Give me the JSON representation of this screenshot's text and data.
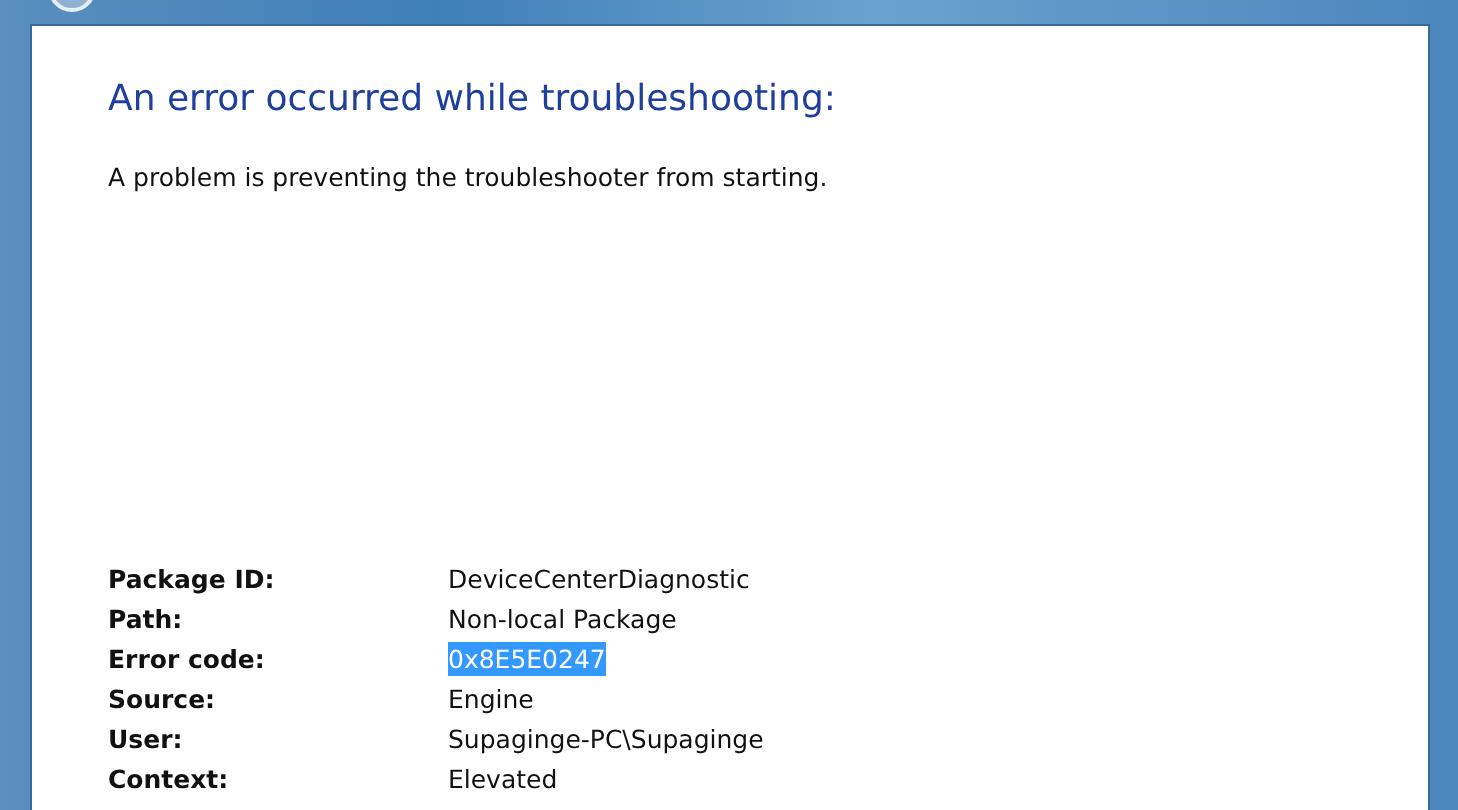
{
  "heading": "An error occurred while troubleshooting:",
  "message": "A problem is preventing the troubleshooter from starting.",
  "details": [
    {
      "label": "Package ID:",
      "value": "DeviceCenterDiagnostic",
      "selected": false
    },
    {
      "label": "Path:",
      "value": "Non-local Package",
      "selected": false
    },
    {
      "label": "Error code:",
      "value": "0x8E5E0247",
      "selected": true
    },
    {
      "label": "Source:",
      "value": "Engine",
      "selected": false
    },
    {
      "label": "User:",
      "value": "Supaginge-PC\\Supaginge",
      "selected": false
    },
    {
      "label": "Context:",
      "value": "Elevated",
      "selected": false
    }
  ]
}
